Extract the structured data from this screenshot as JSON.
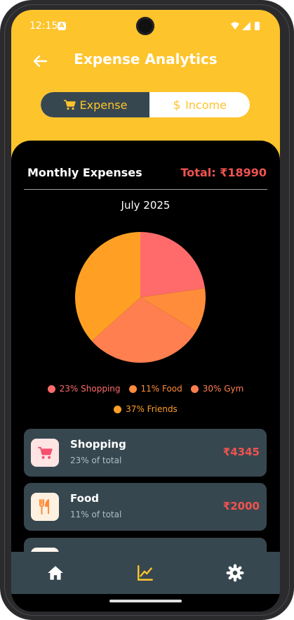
{
  "status_bar": {
    "time": "12:15",
    "notif_glyph": "A",
    "icons": [
      "wifi-icon",
      "signal-icon",
      "battery-icon"
    ]
  },
  "header": {
    "title": "Expense Analytics",
    "back_icon": "arrow-left-icon"
  },
  "toggle": {
    "expense_label": "Expense",
    "income_label": "Income",
    "selected": "expense"
  },
  "summary": {
    "title": "Monthly Expenses",
    "total": "Total: ₹18990",
    "month": "July 2025"
  },
  "chart_data": {
    "type": "pie",
    "slices": [
      {
        "name": "Shopping",
        "percent": 23,
        "color": "#ff6b6b"
      },
      {
        "name": "Food",
        "percent": 11,
        "color": "#ff8c3a"
      },
      {
        "name": "Gym",
        "percent": 30,
        "color": "#ff7f50"
      },
      {
        "name": "Friends",
        "percent": 37,
        "color": "#ffa024"
      }
    ]
  },
  "legend": [
    {
      "label": "23% Shopping",
      "color": "#ff6b6b"
    },
    {
      "label": "11% Food",
      "color": "#ff8c3a"
    },
    {
      "label": "30% Gym",
      "color": "#ff7f50"
    },
    {
      "label": "37% Friends",
      "color": "#ffa024"
    }
  ],
  "categories": [
    {
      "name": "Shopping",
      "subtitle": "23% of total",
      "amount": "₹4345",
      "icon": "cart-icon",
      "icon_bg": "#ffe4e4",
      "icon_color": "#f4516c"
    },
    {
      "name": "Food",
      "subtitle": "11% of total",
      "amount": "₹2000",
      "icon": "fork-knife-icon",
      "icon_bg": "#fff1e0",
      "icon_color": "#ff8c3a"
    }
  ],
  "nav": [
    {
      "name": "home",
      "icon": "home-icon"
    },
    {
      "name": "analytics",
      "icon": "chart-icon",
      "active": true
    },
    {
      "name": "settings",
      "icon": "gear-icon"
    }
  ],
  "colors": {
    "accent": "#fec42c",
    "card": "#37474f",
    "negative": "#ef5350"
  }
}
